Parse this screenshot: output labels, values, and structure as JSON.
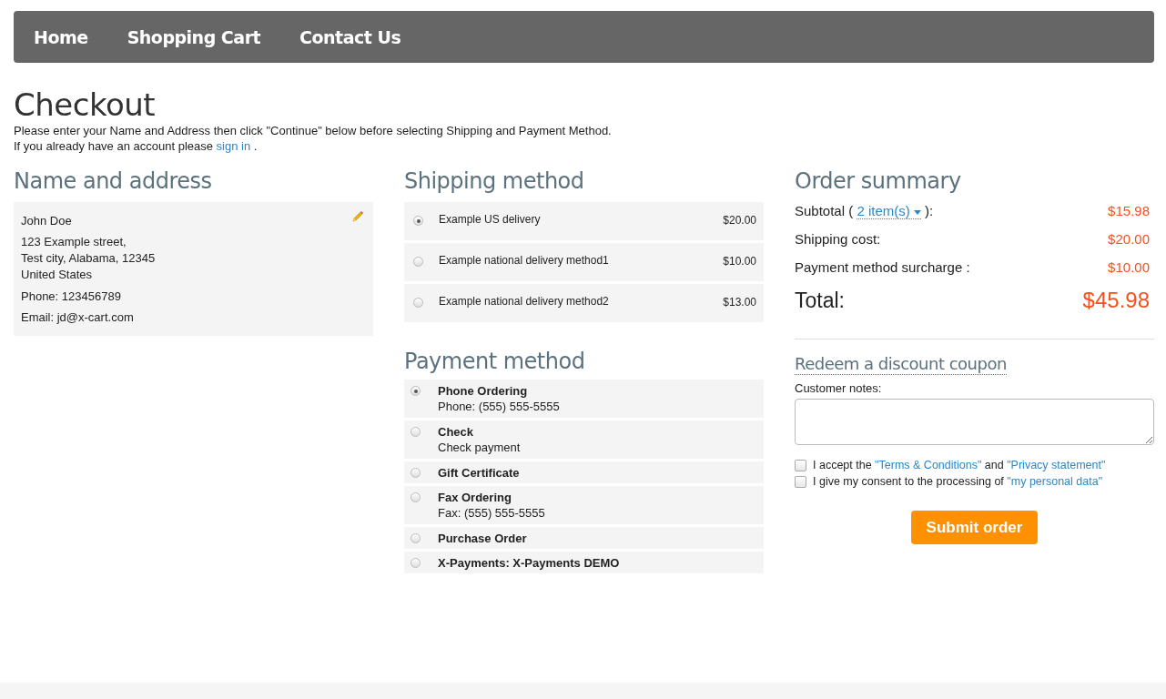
{
  "nav": [
    "Home",
    "Shopping Cart",
    "Contact Us"
  ],
  "page_title": "Checkout",
  "intro": "Please enter your Name and Address then click \"Continue\" below before selecting Shipping and Payment Method.",
  "signin": [
    {
      "kind": "text",
      "text": "If you already have an account please"
    },
    {
      "kind": "link",
      "text": "sign in"
    },
    {
      "kind": "text",
      "text": "."
    }
  ],
  "address": {
    "heading": "Name and address",
    "name": "John Doe",
    "lines": [
      "123 Example street,",
      "Test city, Alabama, 12345",
      "United States"
    ],
    "phone": "Phone: 123456789",
    "email": "Email: jd@x-cart.com"
  },
  "shipping": {
    "heading": "Shipping method",
    "options": [
      {
        "label": "Example US delivery",
        "price": "$20.00",
        "selected": true
      },
      {
        "label": "Example national delivery method1",
        "price": "$10.00",
        "selected": false
      },
      {
        "label": "Example national delivery method2",
        "price": "$13.00",
        "selected": false
      }
    ]
  },
  "payment": {
    "heading": "Payment method",
    "options": [
      {
        "name": "Phone Ordering",
        "detail": "Phone: (555) 555-5555",
        "selected": true
      },
      {
        "name": "Check",
        "detail": "Check payment",
        "selected": false
      },
      {
        "name": "Gift Certificate",
        "selected": false
      },
      {
        "name": "Fax Ordering",
        "detail": "Fax: (555) 555-5555",
        "selected": false
      },
      {
        "name": "Purchase Order",
        "selected": false
      },
      {
        "name": "X-Payments: X-Payments DEMO",
        "selected": false
      }
    ]
  },
  "summary": {
    "heading": "Order summary",
    "subtotal": {
      "before": "Subtotal (",
      "link": "2 item(s)",
      "after": "):",
      "value": "$15.98"
    },
    "rows": [
      {
        "label": "Shipping cost:",
        "value": "$20.00"
      },
      {
        "label": "Payment method surcharge :",
        "value": "$10.00"
      }
    ],
    "total": {
      "label": "Total:",
      "value": "$45.98"
    }
  },
  "coupon": "Redeem a discount coupon",
  "notes_label": "Customer notes:",
  "agreements": [
    {
      "checked": false,
      "parts": [
        {
          "kind": "text",
          "text": "I accept the"
        },
        {
          "kind": "link",
          "text": "\"Terms & Conditions\""
        },
        {
          "kind": "text",
          "text": "and"
        },
        {
          "kind": "link",
          "text": "\"Privacy statement\""
        }
      ]
    },
    {
      "checked": false,
      "parts": [
        {
          "kind": "text",
          "text": "I give my consent to the processing of"
        },
        {
          "kind": "link",
          "text": "\"my personal data\""
        }
      ]
    }
  ],
  "submit": "Submit order"
}
